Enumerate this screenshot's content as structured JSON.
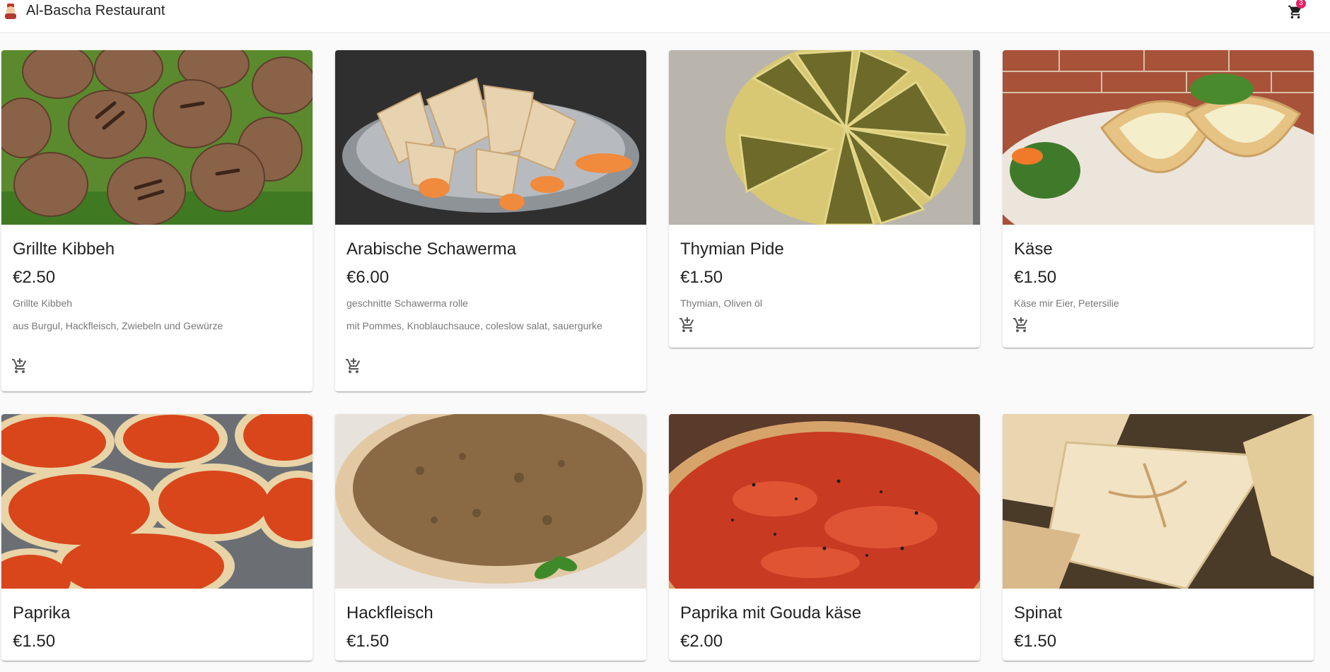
{
  "app": {
    "title": "Al-Bascha Restaurant",
    "cart_count": "3",
    "accent": "#e91e63"
  },
  "products": [
    {
      "name": "Grillte Kibbeh",
      "price": "€2.50",
      "desc": "Grillte Kibbeh",
      "desc2": "aus Burgul, Hackfleisch, Zwiebeln und Gewürze",
      "image": "grilled-kibbeh"
    },
    {
      "name": "Arabische Schawerma",
      "price": "€6.00",
      "desc": "geschnitte Schawerma rolle",
      "desc2": "mit Pommes, Knoblauchsauce, coleslow salat, sauergurke",
      "image": "shawarma-plate"
    },
    {
      "name": "Thymian Pide",
      "price": "€1.50",
      "desc": "Thymian, Oliven öl",
      "desc2": "",
      "image": "zaatar-pide"
    },
    {
      "name": "Käse",
      "price": "€1.50",
      "desc": "Käse mir Eier, Petersilie",
      "desc2": "",
      "image": "cheese-pide"
    },
    {
      "name": "Paprika",
      "price": "€1.50",
      "desc": "",
      "desc2": "",
      "image": "paprika-flatbread"
    },
    {
      "name": "Hackfleisch",
      "price": "€1.50",
      "desc": "",
      "desc2": "",
      "image": "lahmacun"
    },
    {
      "name": "Paprika mit Gouda käse",
      "price": "€2.00",
      "desc": "",
      "desc2": "",
      "image": "paprika-gouda"
    },
    {
      "name": "Spinat",
      "price": "€1.50",
      "desc": "",
      "desc2": "",
      "image": "spinach-fatayer"
    }
  ],
  "icons": {
    "cart": "shopping-cart-icon",
    "add_to_cart": "add-shopping-cart-icon",
    "logo": "restaurant-logo-icon"
  }
}
